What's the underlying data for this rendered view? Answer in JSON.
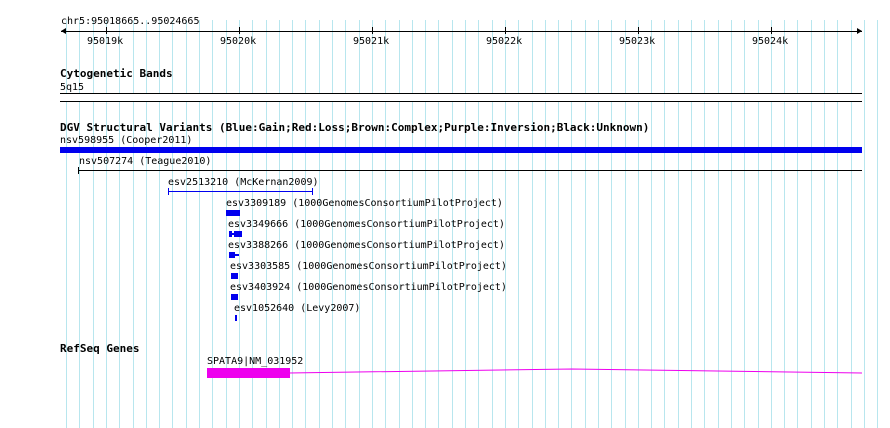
{
  "ruler": {
    "position_label": "chr5:95018665..95024665",
    "ticks": [
      "95019k",
      "95020k",
      "95021k",
      "95022k",
      "95023k",
      "95024k"
    ]
  },
  "cytobands": {
    "title": "Cytogenetic Bands",
    "band": "5q15"
  },
  "dgv": {
    "title": "DGV Structural Variants (Blue:Gain;Red:Loss;Brown:Complex;Purple:Inversion;Black:Unknown)",
    "features": [
      {
        "label": "nsv598955 (Cooper2011)"
      },
      {
        "label": "nsv507274 (Teague2010)"
      },
      {
        "label": "esv2513210 (McKernan2009)"
      },
      {
        "label": "esv3309189 (1000GenomesConsortiumPilotProject)"
      },
      {
        "label": "esv3349666 (1000GenomesConsortiumPilotProject)"
      },
      {
        "label": "esv3388266 (1000GenomesConsortiumPilotProject)"
      },
      {
        "label": "esv3303585 (1000GenomesConsortiumPilotProject)"
      },
      {
        "label": "esv3403924 (1000GenomesConsortiumPilotProject)"
      },
      {
        "label": "esv1052640 (Levy2007)"
      }
    ]
  },
  "refseq": {
    "title": "RefSeq Genes",
    "gene_label": "SPATA9|NM_031952"
  },
  "colors": {
    "gain": "#0000ee",
    "unknown": "#000000",
    "gene": "#ee00ee",
    "grid": "#b8e6ee"
  }
}
